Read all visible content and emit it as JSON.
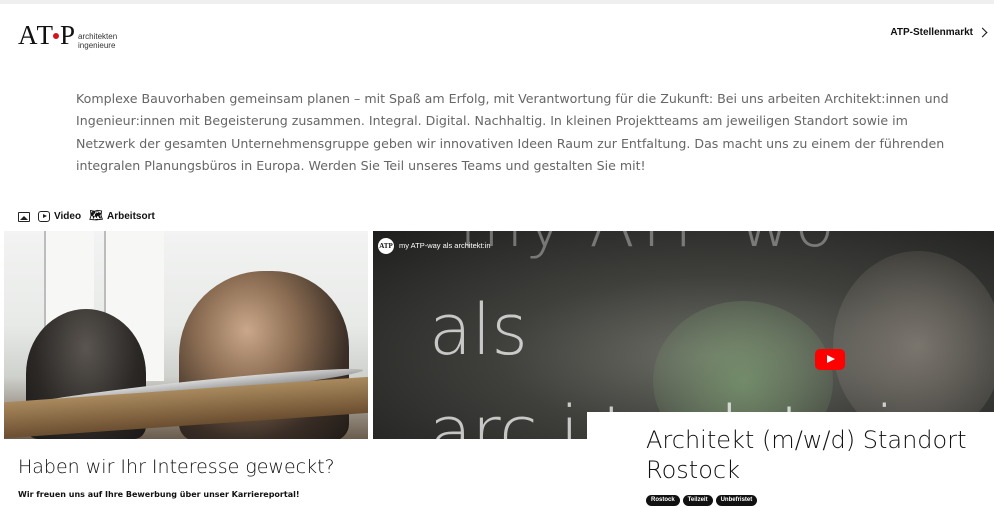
{
  "header": {
    "logo_mark": "ATP",
    "logo_line1": "architekten",
    "logo_line2": "ingenieure",
    "stellenmarkt_label": "ATP-Stellenmarkt"
  },
  "intro_text": "Komplexe Bauvorhaben gemeinsam planen – mit Spaß am Erfolg, mit Verantwortung für die Zukunft: Bei uns arbeiten Architekt:innen und Ingenieur:innen mit Begeisterung zusammen. Integral. Digital. Nachhaltig. In kleinen Projektteams am jeweiligen Standort sowie im Netzwerk der gesamten Unternehmensgruppe geben wir innovativen Ideen Raum zur Entfaltung. Das macht uns zu einem der führenden integralen Planungsbüros in Europa. Werden Sie Teil unseres Teams und gestalten Sie mit!",
  "media_tabs": {
    "image_icon": "image-icon",
    "video_label": "Video",
    "map_label": "Arbeitsort"
  },
  "video": {
    "channel_avatar": "ATP",
    "title": "my ATP-way als architekt:in",
    "overlay_line1": "my ATP wo",
    "overlay_line2": "als",
    "overlay_line3": "arc   i t e k t : i",
    "play_color": "#ff0000"
  },
  "interest": {
    "title": "Haben wir Ihr Interesse geweckt?",
    "subtitle": "Wir freuen uns auf Ihre Bewerbung über unser Karriereportal!"
  },
  "job": {
    "title": "Architekt (m/w/d) Standort Rostock",
    "tags": [
      "Rostock",
      "Teilzeit",
      "Unbefristet"
    ]
  },
  "colors": {
    "accent_red": "#d4141c",
    "text_muted": "#666666",
    "tag_bg": "#111111"
  }
}
